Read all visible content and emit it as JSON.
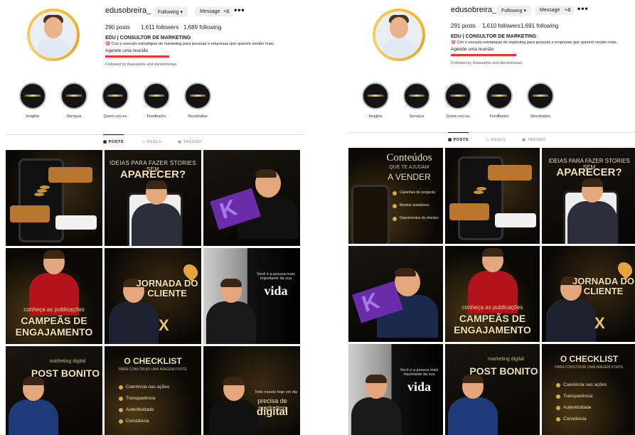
{
  "left": {
    "username": "edusobreira_",
    "following_label": "Following ▾",
    "message_label": "Message",
    "add_icon": "+&",
    "more_icon": "•••",
    "stats": {
      "posts": "290 posts",
      "followers": "1,611 followers",
      "following": "1,689 following"
    },
    "display_name": "EDU | CONSULTOR DE MARKETING",
    "bio_line1": "🎯 Crio e executo estratégias de marketing para pessoas e empresas que querem vender mais.",
    "bio_line2": "Agende uma reunião",
    "followed_by": "Followed by thaissarkis and darwinlisinas",
    "highlights": [
      "Insights",
      "Serviços",
      "Quem sou eu",
      "Feedbacks",
      "Resultados"
    ],
    "tabs": [
      "POSTS",
      "REELS",
      "TAGGED"
    ],
    "tiles": {
      "t2_top": "IDEIAS PARA FAZER STORIES SEM",
      "t2_big": "APARECER?",
      "t3_book": "K",
      "t4_small": "conheça as publicações",
      "t4_big1": "CAMPEÃS DE",
      "t4_big2": "ENGAJAMENTO",
      "t5_title1": "JORNADA DO",
      "t5_title2": "CLIENTE",
      "t5_x": "X",
      "t6_small": "Você é a pessoa mais importante da sua",
      "t6_big": "vida",
      "t7_small": "marketing digital",
      "t7_big": "POST BONITO",
      "t8_title": "O CHECKLIST",
      "t8_sub": "PARA CONSTRUIR UMA IMAGEM FORTE",
      "t8_items": [
        "Coerência nas ações",
        "Transparência",
        "Autenticidade",
        "Constância"
      ],
      "t9_small": "Todo mundo hoje em dia",
      "t9_mid": "precisa de marketing",
      "t9_big": "digital"
    }
  },
  "right": {
    "username": "edusobreira_",
    "following_label": "Following ▾",
    "message_label": "Message",
    "add_icon": "+&",
    "more_icon": "•••",
    "stats": {
      "posts": "291 posts",
      "followers": "1,610 followers",
      "following": "1,691 following"
    },
    "display_name": "EDU | CONSULTOR DE MARKETING",
    "bio_line1": "🎯 Crio e executo estratégias de marketing para pessoas e empresas que querem vender mais.",
    "bio_line2": "Agende uma reunião",
    "followed_by": "Followed by thaissarkis and darwinlisinas",
    "highlights": [
      "Insights",
      "Serviços",
      "Quem sou eu",
      "Feedbacks",
      "Resultados"
    ],
    "tabs": [
      "POSTS",
      "REELS",
      "TAGGED"
    ],
    "tiles": {
      "t1_title1": "Conteúdos",
      "t1_title2": "QUE TE AJUDAM",
      "t1_title3": "A VENDER",
      "t1_items": [
        "Caixinhas de pergunta",
        "Mostrar bastidores",
        "Depoimentos de clientes"
      ]
    }
  }
}
